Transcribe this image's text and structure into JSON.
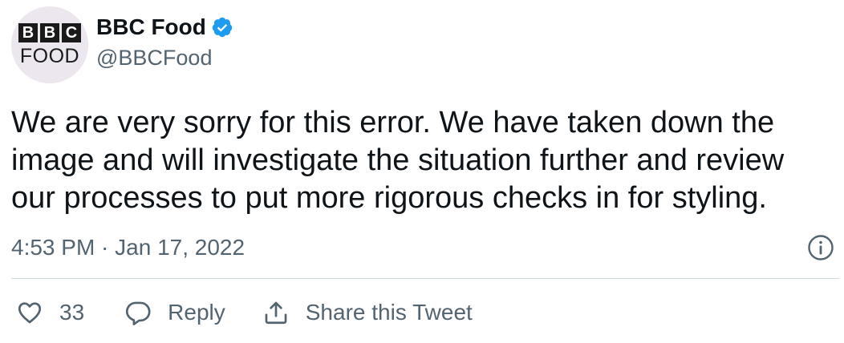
{
  "author": {
    "avatar_logo_letters": [
      "B",
      "B",
      "C"
    ],
    "avatar_logo_word": "FOOD",
    "display_name": "BBC Food",
    "handle": "@BBCFood",
    "verified_icon": "verified-badge-icon",
    "verified_color": "#1d9bf0"
  },
  "tweet": {
    "text": "We are very sorry for this error. We have taken down the image and will investigate the situation further and review our processes to put more rigorous checks in for styling.",
    "timestamp": "4:53 PM · Jan 17, 2022"
  },
  "actions": {
    "like_count": "33",
    "reply_label": "Reply",
    "share_label": "Share this Tweet"
  },
  "colors": {
    "text_primary": "#0f1419",
    "text_secondary": "#536471",
    "divider": "#cfd9de",
    "avatar_bg": "#ece6ee"
  }
}
